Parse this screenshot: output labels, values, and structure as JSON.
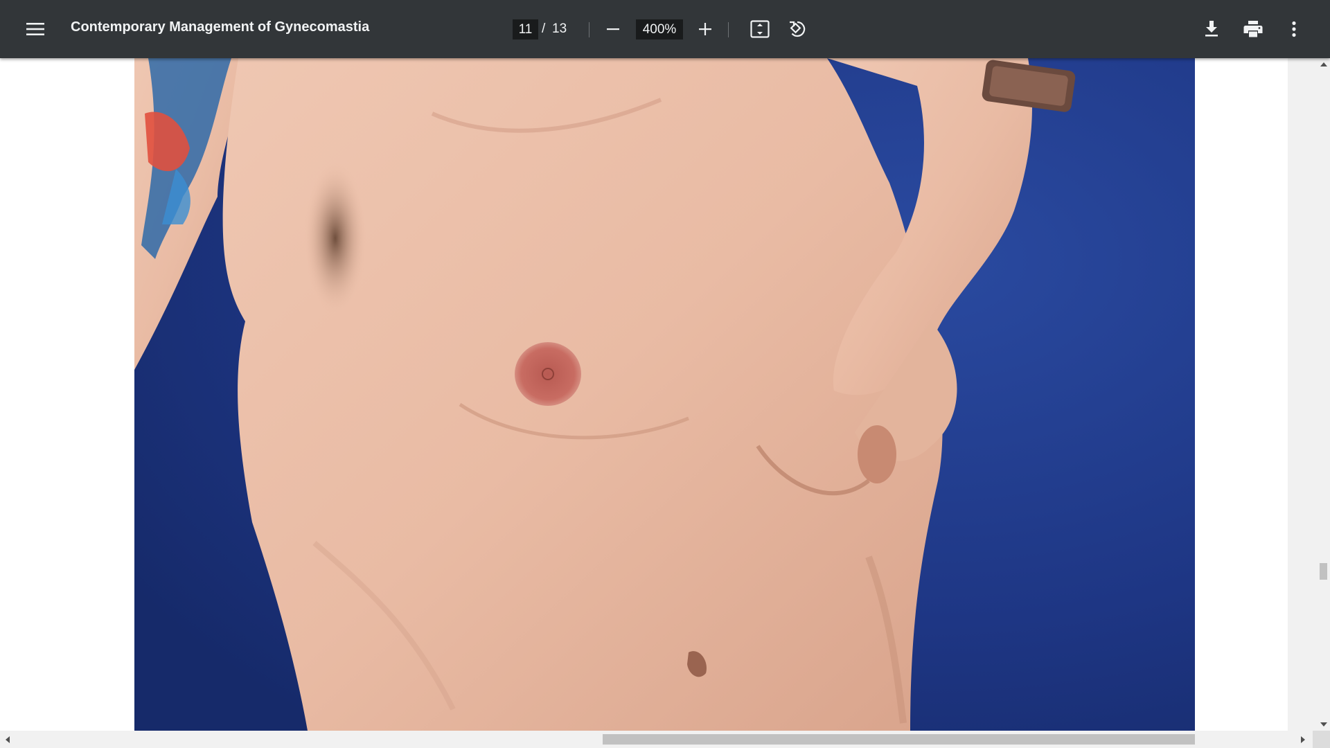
{
  "toolbar": {
    "menu_icon": "hamburger-menu-icon",
    "title": "Contemporary Management of Gynecomastia",
    "page_current": "11",
    "page_separator": "/",
    "page_total": "13",
    "zoom_out_icon": "minus-icon",
    "zoom_value": "400%",
    "zoom_in_icon": "plus-icon",
    "fit_icon": "fit-to-page-icon",
    "rotate_icon": "rotate-counterclockwise-icon",
    "download_icon": "download-icon",
    "print_icon": "print-icon",
    "more_icon": "more-vert-icon"
  },
  "document": {
    "page_image": "clinical-photo-torso-gynecomastia",
    "background_color": "#1d3480"
  },
  "scrollbars": {
    "vertical_position": 0.75,
    "horizontal_position": 0.6
  }
}
